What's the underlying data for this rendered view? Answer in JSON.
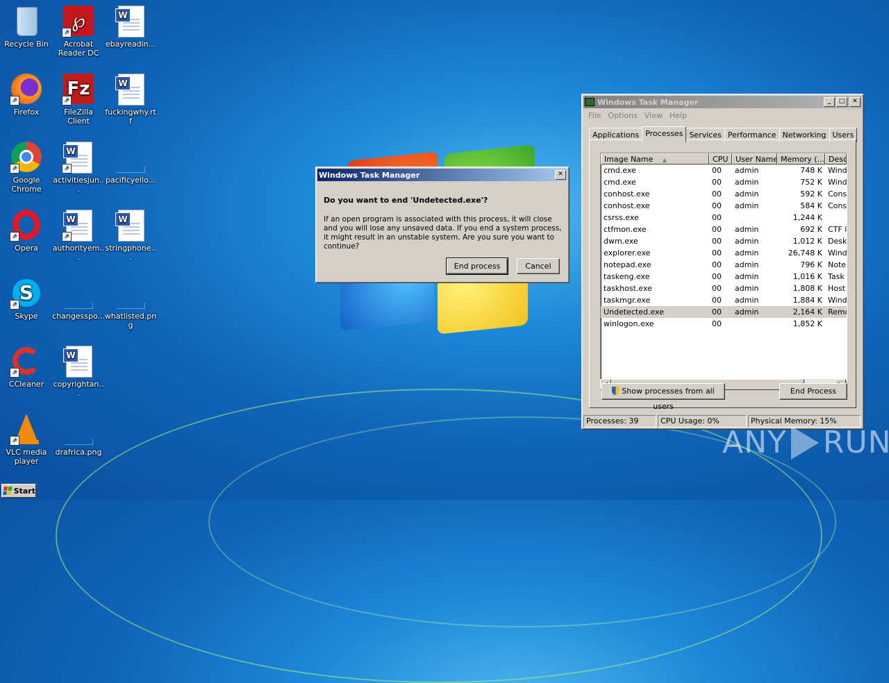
{
  "desktop_icons": [
    {
      "label": "Recycle Bin",
      "icon": "recycle-bin-icon"
    },
    {
      "label": "Acrobat Reader DC",
      "icon": "acrobat-icon"
    },
    {
      "label": "ebayreadin...",
      "icon": "word-doc-icon"
    },
    {
      "label": "Firefox",
      "icon": "firefox-icon"
    },
    {
      "label": "FileZilla Client",
      "icon": "filezilla-icon"
    },
    {
      "label": "fuckingwhy.rtf",
      "icon": "word-doc-icon"
    },
    {
      "label": "Google Chrome",
      "icon": "chrome-icon"
    },
    {
      "label": "activitiesjun...",
      "icon": "word-doc-icon"
    },
    {
      "label": "pacificyello...",
      "icon": "blank-file-icon"
    },
    {
      "label": "Opera",
      "icon": "opera-icon"
    },
    {
      "label": "authorityem...",
      "icon": "word-doc-icon"
    },
    {
      "label": "stringphone...",
      "icon": "word-doc-icon"
    },
    {
      "label": "Skype",
      "icon": "skype-icon"
    },
    {
      "label": "changesspo...",
      "icon": "blank-file-icon"
    },
    {
      "label": "whatlisted.png",
      "icon": "blank-file-icon"
    },
    {
      "label": "CCleaner",
      "icon": "ccleaner-icon"
    },
    {
      "label": "copyrightan...",
      "icon": "word-doc-icon"
    },
    {
      "label": "VLC media player",
      "icon": "vlc-icon"
    },
    {
      "label": "drafrica.png",
      "icon": "blank-file-icon"
    }
  ],
  "task_manager": {
    "title": "Windows Task Manager",
    "menu": [
      "File",
      "Options",
      "View",
      "Help"
    ],
    "tabs": [
      "Applications",
      "Processes",
      "Services",
      "Performance",
      "Networking",
      "Users"
    ],
    "selected_tab": "Processes",
    "columns": [
      "Image Name",
      "CPU",
      "User Name",
      "Memory (...",
      "Desc"
    ],
    "processes": [
      {
        "name": "cmd.exe",
        "cpu": "00",
        "user": "admin",
        "memory": "748 K",
        "desc": "Wind"
      },
      {
        "name": "cmd.exe",
        "cpu": "00",
        "user": "admin",
        "memory": "752 K",
        "desc": "Wind"
      },
      {
        "name": "conhost.exe",
        "cpu": "00",
        "user": "admin",
        "memory": "592 K",
        "desc": "Cons"
      },
      {
        "name": "conhost.exe",
        "cpu": "00",
        "user": "admin",
        "memory": "584 K",
        "desc": "Cons"
      },
      {
        "name": "csrss.exe",
        "cpu": "00",
        "user": "",
        "memory": "1,244 K",
        "desc": ""
      },
      {
        "name": "ctfmon.exe",
        "cpu": "00",
        "user": "admin",
        "memory": "692 K",
        "desc": "CTF l"
      },
      {
        "name": "dwm.exe",
        "cpu": "00",
        "user": "admin",
        "memory": "1,012 K",
        "desc": "Desk"
      },
      {
        "name": "explorer.exe",
        "cpu": "00",
        "user": "admin",
        "memory": "26,748 K",
        "desc": "Wind"
      },
      {
        "name": "notepad.exe",
        "cpu": "00",
        "user": "admin",
        "memory": "796 K",
        "desc": "Note"
      },
      {
        "name": "taskeng.exe",
        "cpu": "00",
        "user": "admin",
        "memory": "1,016 K",
        "desc": "Task"
      },
      {
        "name": "taskhost.exe",
        "cpu": "00",
        "user": "admin",
        "memory": "1,808 K",
        "desc": "Host"
      },
      {
        "name": "taskmgr.exe",
        "cpu": "00",
        "user": "admin",
        "memory": "1,884 K",
        "desc": "Wind"
      },
      {
        "name": "Undetected.exe",
        "cpu": "00",
        "user": "admin",
        "memory": "2,164 K",
        "desc": "Remo"
      },
      {
        "name": "winlogon.exe",
        "cpu": "00",
        "user": "",
        "memory": "1,852 K",
        "desc": ""
      }
    ],
    "show_all_label": "Show processes from all users",
    "end_process_label": "End Process",
    "status": {
      "processes": "Processes: 39",
      "cpu": "CPU Usage: 0%",
      "memory": "Physical Memory: 15%"
    }
  },
  "dialog": {
    "title": "Windows Task Manager",
    "question": "Do you want to end 'Undetected.exe'?",
    "message": "If an open program is associated with this process, it will close and you will lose any unsaved data. If you end a system process, it might result in an unstable system. Are you sure you want to continue?",
    "ok_label": "End process",
    "cancel_label": "Cancel"
  },
  "taskbar": {
    "start_label": "Start"
  },
  "watermark": {
    "text": "ANY",
    "text2": "RUN"
  },
  "colors": {
    "desktop": "#1d8ad9",
    "window": "#d4d0c8",
    "active_title": "#0a246a"
  }
}
